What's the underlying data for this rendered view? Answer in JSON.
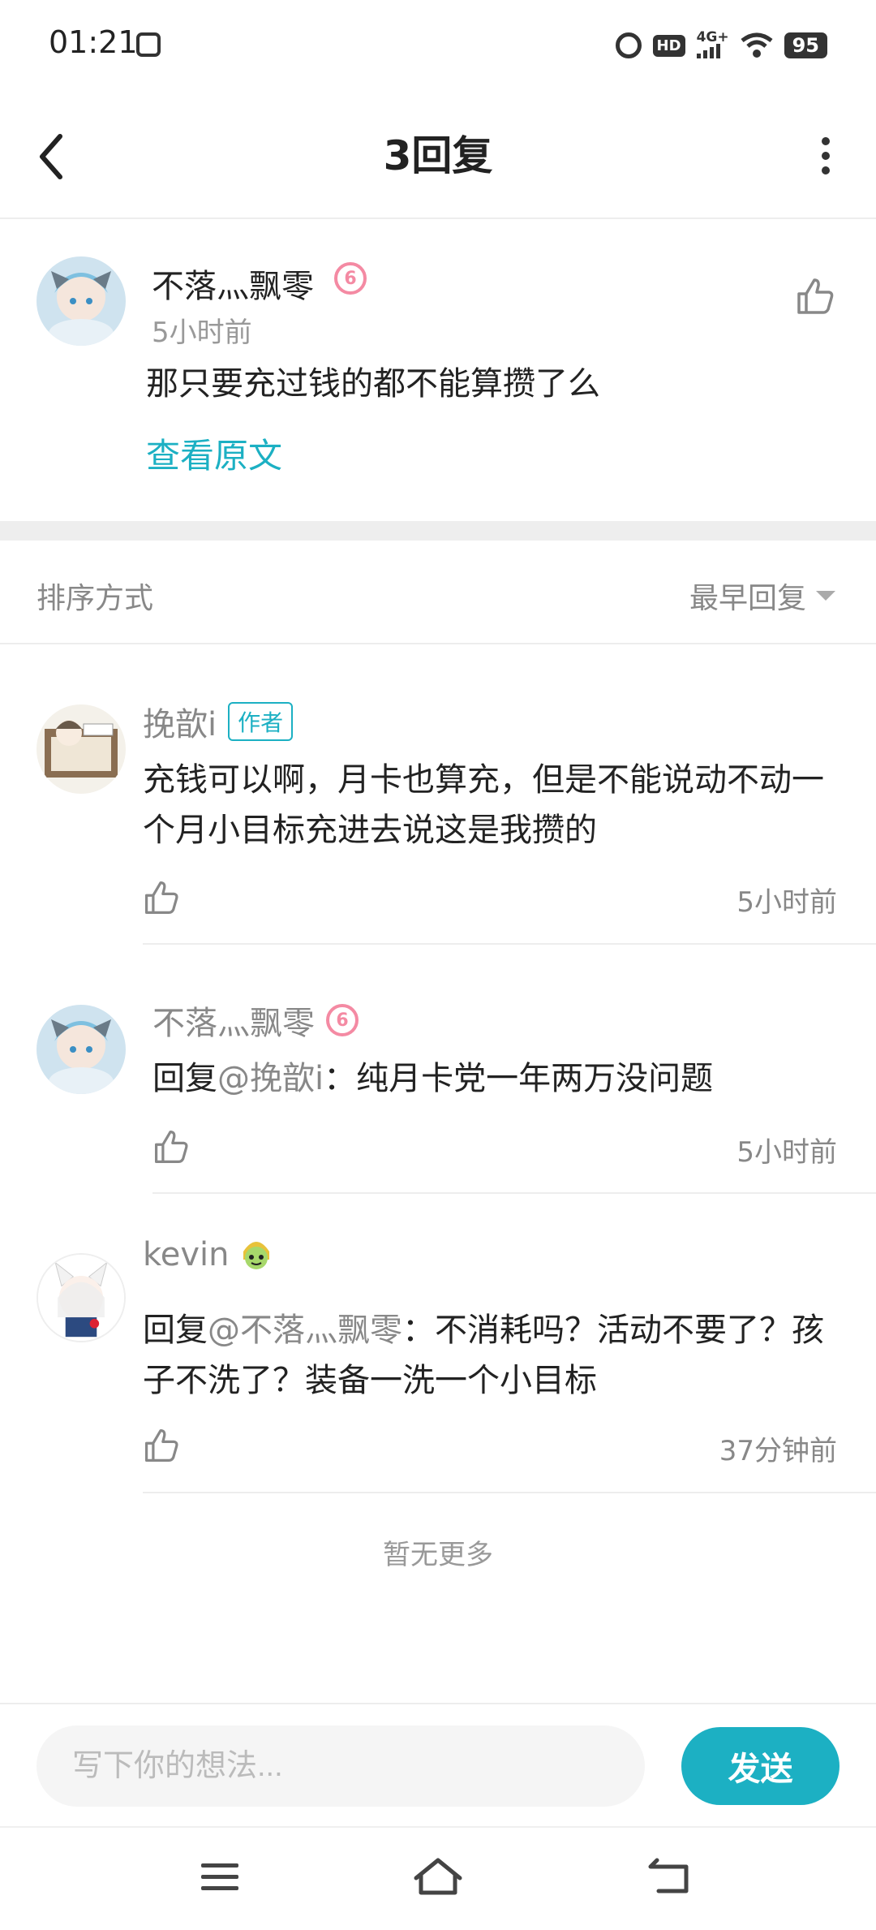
{
  "status_bar": {
    "time": "01:21",
    "network": "4G+",
    "hd": "HD",
    "battery": "95"
  },
  "header": {
    "title": "3回复"
  },
  "original_comment": {
    "username": "不落灬飘零",
    "level": "6",
    "time": "5小时前",
    "content": "那只要充过钱的都不能算攒了么",
    "view_original_label": "查看原文"
  },
  "sort": {
    "label": "排序方式",
    "value": "最早回复"
  },
  "replies": [
    {
      "username": "挽歆i",
      "badge": "作者",
      "content": "充钱可以啊，月卡也算充，但是不能说动不动一个月小目标充进去说这是我攒的",
      "time": "5小时前"
    },
    {
      "username": "不落灬飘零",
      "level": "6",
      "reply_prefix": "回复",
      "mention": "@挽歆i",
      "content": "：纯月卡党一年两万没问题",
      "time": "5小时前"
    },
    {
      "username": "kevin",
      "reply_prefix": "回复",
      "mention": "@不落灬飘零",
      "content": "：不消耗吗？活动不要了？孩子不洗了？装备一洗一个小目标",
      "time": "37分钟前"
    }
  ],
  "no_more": "暂无更多",
  "input": {
    "placeholder": "写下你的想法...",
    "send_label": "发送"
  },
  "colors": {
    "accent": "#1cb0c3",
    "level_badge": "#f48aa3"
  }
}
